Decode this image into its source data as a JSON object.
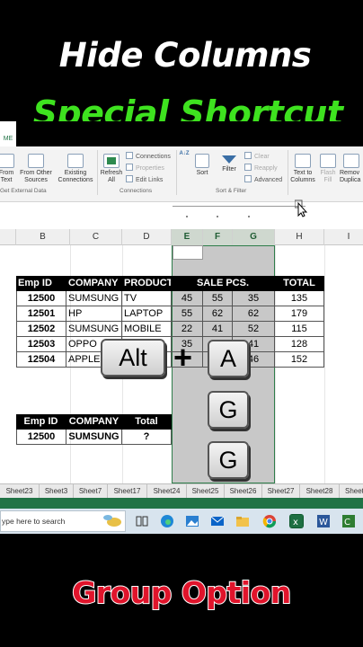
{
  "titles": {
    "top1": "Hide Columns",
    "top2": "Special Shortcut",
    "bottom": "Group Option",
    "top2_color": "#3ee21f",
    "bottom_color": "#e0142b"
  },
  "ribbon": {
    "file_tab": "ME",
    "from_text": "From\nText",
    "from_other": "From Other\nSources",
    "existing": "Existing\nConnections",
    "refresh_all": "Refresh\nAll",
    "connections": "Connections",
    "properties": "Properties",
    "edit_links": "Edit Links",
    "sort": "Sort",
    "filter": "Filter",
    "clear": "Clear",
    "reapply": "Reapply",
    "advanced": "Advanced",
    "text_to_columns": "Text to\nColumns",
    "flash_fill": "Flash\nFill",
    "remove_duplicates": "Remov\nDuplica",
    "group_get_external": "Get External Data",
    "group_connections": "Connections",
    "group_sort_filter": "Sort & Filter",
    "accent": "#217346"
  },
  "columns": [
    "B",
    "C",
    "D",
    "E",
    "F",
    "G",
    "H",
    "I"
  ],
  "table1": {
    "headers": [
      "Emp ID",
      "COMPANY",
      "PRODUCTS",
      "SALE PCS.",
      "TOTAL"
    ],
    "rows": [
      {
        "id": "12500",
        "company": "SUMSUNG",
        "product": "TV",
        "e": "45",
        "f": "55",
        "g": "35",
        "total": "135"
      },
      {
        "id": "12501",
        "company": "HP",
        "product": "LAPTOP",
        "e": "55",
        "f": "62",
        "g": "62",
        "total": "179"
      },
      {
        "id": "12502",
        "company": "SUMSUNG",
        "product": "MOBILE",
        "e": "22",
        "f": "41",
        "g": "52",
        "total": "115"
      },
      {
        "id": "12503",
        "company": "OPPO",
        "product": "",
        "e": "35",
        "f": "",
        "g": "41",
        "total": "128"
      },
      {
        "id": "12504",
        "company": "APPLE",
        "product": "",
        "e": "",
        "f": "",
        "g": "46",
        "total": "152"
      }
    ]
  },
  "table2": {
    "headers": [
      "Emp ID",
      "COMPANY",
      "Total"
    ],
    "row": {
      "id": "12500",
      "company": "SUMSUNG",
      "total": "?"
    }
  },
  "keys": {
    "alt": "Alt",
    "plus": "+",
    "a": "A",
    "g1": "G",
    "g2": "G"
  },
  "sheet_tabs": [
    "Sheet23",
    "Sheet3",
    "Sheet7",
    "Sheet17",
    "Sheet24",
    "Sheet25",
    "Sheet26",
    "Sheet27",
    "Sheet28",
    "Sheet"
  ],
  "taskbar": {
    "search_placeholder": "ype here to search"
  }
}
